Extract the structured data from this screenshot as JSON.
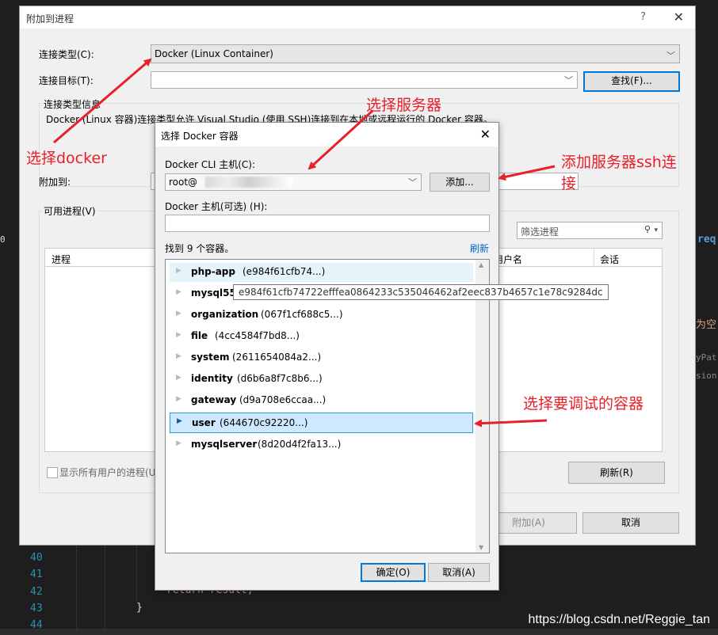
{
  "editor": {
    "line_numbers": [
      "40",
      "41",
      "42",
      "43",
      "44"
    ],
    "code_return": "return result;",
    "code_brace": "}",
    "right_snippets": [
      "req",
      "为空",
      "yPat",
      "sion("
    ],
    "gutter_mark": "0"
  },
  "outer_dialog": {
    "title": "附加到进程",
    "help": "?",
    "close": "✕",
    "connection_type_label": "连接类型(C):",
    "connection_type_value": "Docker (Linux Container)",
    "connection_target_label": "连接目标(T):",
    "connection_target_value": "",
    "find_button": "查找(F)...",
    "connection_info_label": "连接类型信息",
    "connection_info_text": "Docker (Linux 容器)连接类型允许 Visual Studio (使用 SSH)连接到在本地或远程运行的 Docker 容器。",
    "attach_to_label": "附加到:",
    "available_processes_label": "可用进程(V)",
    "filter_placeholder": "筛选进程",
    "columns": [
      "进程",
      "用户名",
      "会话"
    ],
    "show_all_users": "显示所有用户的进程(U)",
    "refresh_button": "刷新(R)",
    "attach_button": "附加(A)",
    "cancel_button": "取消"
  },
  "inner_dialog": {
    "title": "选择 Docker 容器",
    "close": "✕",
    "cli_host_label": "Docker CLI 主机(C):",
    "cli_host_value": "root@",
    "add_button": "添加...",
    "docker_host_label": "Docker 主机(可选) (H):",
    "docker_host_value": "",
    "found_text": "找到 9 个容器。",
    "refresh_link": "刷新",
    "containers": [
      {
        "name": "php-app",
        "id": "(e984f61cfb74...)"
      },
      {
        "name": "mysql55",
        "id": "("
      },
      {
        "name": "organization",
        "id": "(067f1cf688c5...)"
      },
      {
        "name": "file",
        "id": "(4cc4584f7bd8...)"
      },
      {
        "name": "system",
        "id": "(2611654084a2...)"
      },
      {
        "name": "identity",
        "id": "(d6b6a8f7c8b6...)"
      },
      {
        "name": "gateway",
        "id": "(d9a708e6ccaa...)"
      },
      {
        "name": "user",
        "id": "(644670c92220...)"
      },
      {
        "name": "mysqlserver",
        "id": "(8d20d4f2fa13...)"
      }
    ],
    "tooltip": "e984f61cfb74722efffea0864233c535046462af2eec837b4657c1e78c9284dc",
    "ok_button": "确定(O)",
    "cancel_button": "取消(A)"
  },
  "annotations": {
    "select_docker": "选择docker",
    "select_server": "选择服务器",
    "add_ssh_line1": "添加服务器ssh连",
    "add_ssh_line2": "接",
    "select_container": "选择要调试的容器"
  },
  "watermark": "https://blog.csdn.net/Reggie_tan",
  "colors": {
    "annotation": "#e8202a",
    "selection": "#cde8ff",
    "selection_border": "#26a0da",
    "link": "#0066cc",
    "editor_bg": "#1e1e1e"
  }
}
